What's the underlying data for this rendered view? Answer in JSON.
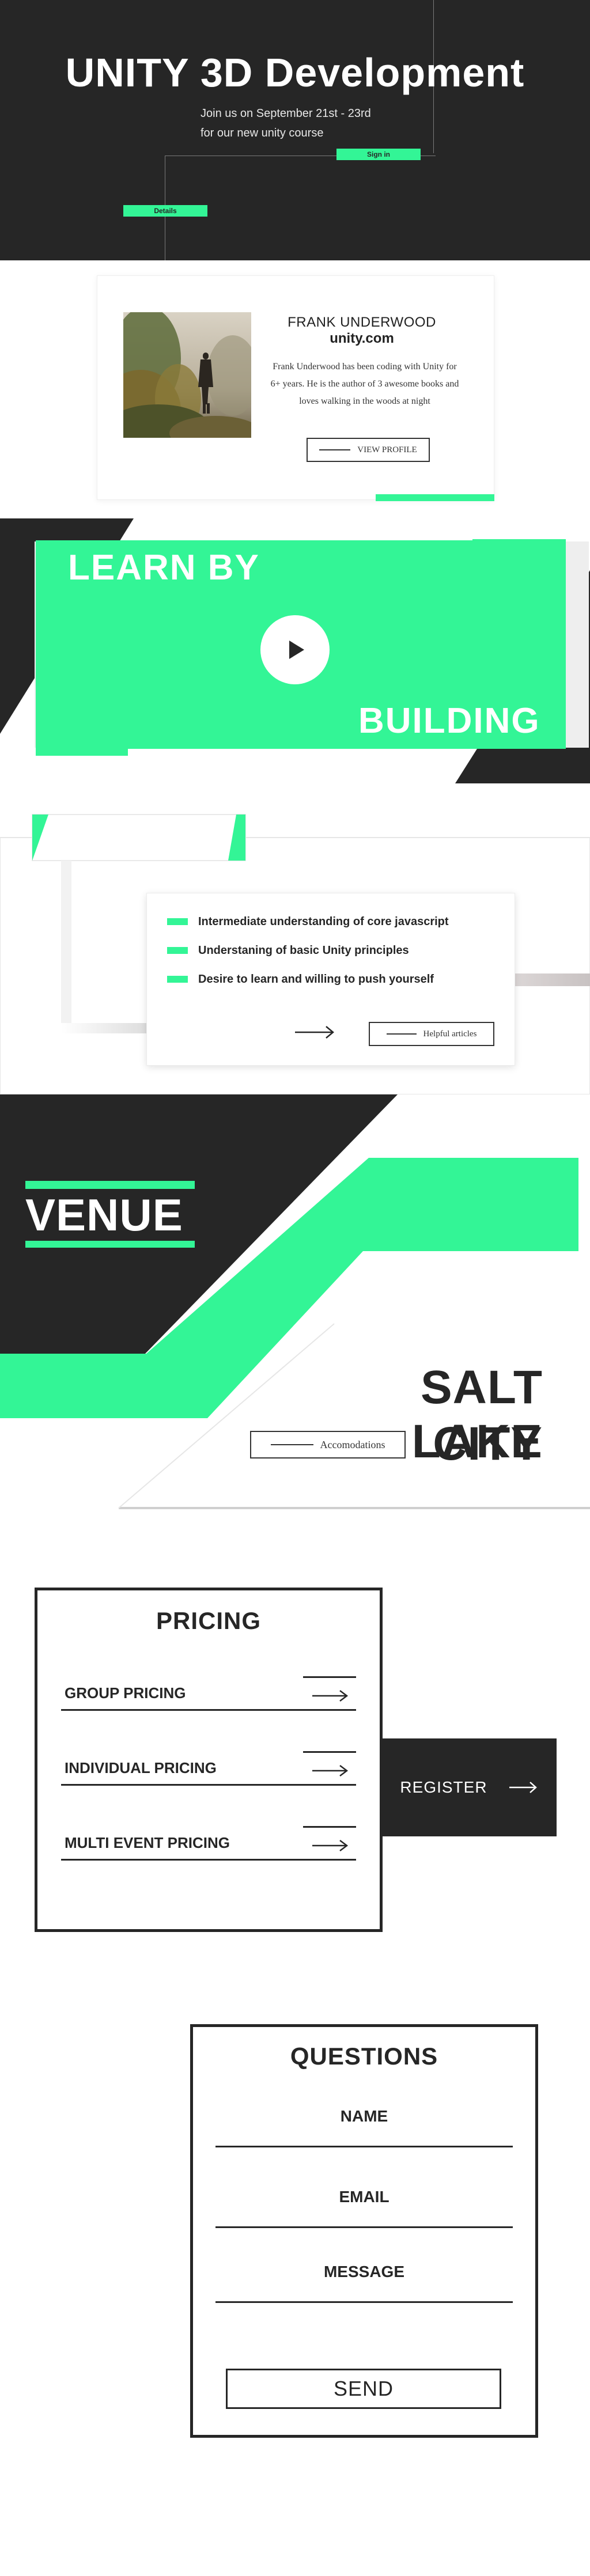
{
  "colors": {
    "dark": "#262626",
    "accent_green": "#33f596",
    "white": "#ffffff"
  },
  "hero": {
    "title": "UNITY 3D Development",
    "subtitle_line1": "Join us on September 21st - 23rd",
    "subtitle_line2": "for our new unity course",
    "signin_label": "Sign in",
    "details_label": "Details"
  },
  "profile": {
    "name": "FRANK UNDERWOOD",
    "site": "unity.com",
    "bio": "Frank Underwood has been coding with Unity for 6+ years. He is the author of 3 awesome books and loves walking in the woods at night",
    "button_label": "VIEW PROFILE",
    "photo_icon": "person-in-forest-photo"
  },
  "learn": {
    "title_top": "LEARN BY",
    "title_bottom": "BUILDING",
    "play_icon": "play-icon"
  },
  "requirements": {
    "items": [
      "Intermediate understanding of core javascript",
      "Understaning of basic Unity principles",
      "Desire to learn and willing to push yourself"
    ],
    "arrow_icon": "arrow-right-icon",
    "button_label": "Helpful articles"
  },
  "venue": {
    "title": "VENUE",
    "city_line1": "SALT LAKE",
    "city_line2": "CITY",
    "button_label": "Accomodations"
  },
  "pricing": {
    "title": "PRICING",
    "rows": [
      "GROUP PRICING",
      "INDIVIDUAL PRICING",
      "MULTI EVENT PRICING"
    ],
    "register_label": "REGISTER",
    "arrow_icon": "arrow-right-icon"
  },
  "questions": {
    "title": "QUESTIONS",
    "fields": [
      "NAME",
      "EMAIL",
      "MESSAGE"
    ],
    "send_label": "SEND"
  }
}
